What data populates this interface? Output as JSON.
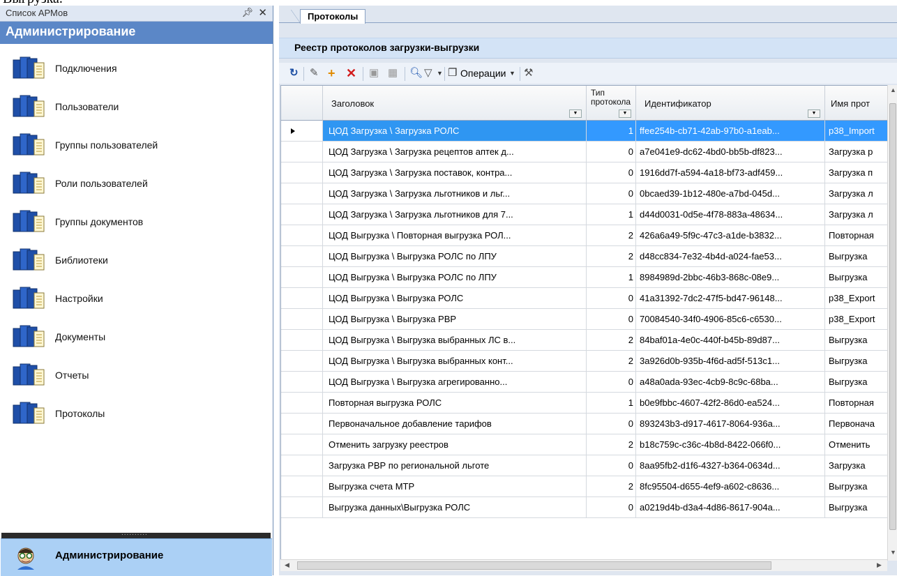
{
  "top_cut_text": "Выгрузка.",
  "left_panel": {
    "caption": "Список АРМов",
    "pin_icon": "pin-icon",
    "close_symbol": "✕",
    "header": "Администрирование",
    "items": [
      {
        "label": "Подключения"
      },
      {
        "label": "Пользователи"
      },
      {
        "label": "Группы пользователей"
      },
      {
        "label": "Роли пользователей"
      },
      {
        "label": "Группы документов"
      },
      {
        "label": "Библиотеки"
      },
      {
        "label": "Настройки"
      },
      {
        "label": "Документы"
      },
      {
        "label": "Отчеты"
      },
      {
        "label": "Протоколы"
      }
    ],
    "splitter_dots": "..........",
    "bottom_label": "Администрирование"
  },
  "tab": {
    "label": "Протоколы"
  },
  "panel_title": "Реестр протоколов загрузки-выгрузки",
  "toolbar": {
    "operations_label": "Операции"
  },
  "grid": {
    "columns": [
      "Заголовок",
      "Тип протокола",
      "Идентификатор",
      "Имя прот"
    ],
    "rows": [
      [
        "ЦОД Загрузка \\ Загрузка РОЛС",
        "1",
        "ffee254b-cb71-42ab-97b0-a1eab...",
        "p38_Import"
      ],
      [
        "ЦОД Загрузка \\ Загрузка рецептов аптек д...",
        "0",
        "a7e041e9-dc62-4bd0-bb5b-df823...",
        "Загрузка р"
      ],
      [
        "ЦОД Загрузка \\ Загрузка поставок, контра...",
        "0",
        "1916dd7f-a594-4a18-bf73-adf459...",
        "Загрузка п"
      ],
      [
        "ЦОД Загрузка \\ Загрузка льготников и льг...",
        "0",
        "0bcaed39-1b12-480e-a7bd-045d...",
        "Загрузка л"
      ],
      [
        "ЦОД Загрузка \\ Загрузка льготников для 7...",
        "1",
        "d44d0031-0d5e-4f78-883a-48634...",
        "Загрузка л"
      ],
      [
        "ЦОД Выгрузка \\ Повторная выгрузка РОЛ...",
        "2",
        "426a6a49-5f9c-47c3-a1de-b3832...",
        "Повторная"
      ],
      [
        "ЦОД Выгрузка \\ Выгрузка РОЛС по ЛПУ",
        "2",
        "d48cc834-7e32-4b4d-a024-fae53...",
        "Выгрузка"
      ],
      [
        "ЦОД Выгрузка \\ Выгрузка РОЛС по ЛПУ",
        "1",
        "8984989d-2bbc-46b3-868c-08e9...",
        "Выгрузка"
      ],
      [
        "ЦОД Выгрузка \\ Выгрузка РОЛС",
        "0",
        "41a31392-7dc2-47f5-bd47-96148...",
        "p38_Export"
      ],
      [
        "ЦОД Выгрузка \\ Выгрузка РВР",
        "0",
        "70084540-34f0-4906-85c6-c6530...",
        "p38_Export"
      ],
      [
        "ЦОД Выгрузка \\ Выгрузка выбранных ЛС в...",
        "2",
        "84baf01a-4e0c-440f-b45b-89d87...",
        "Выгрузка"
      ],
      [
        "ЦОД Выгрузка \\ Выгрузка выбранных конт...",
        "2",
        "3a926d0b-935b-4f6d-ad5f-513c1...",
        "Выгрузка"
      ],
      [
        "ЦОД Выгрузка \\  Выгрузка агрегированно...",
        "0",
        "a48a0ada-93ec-4cb9-8c9c-68ba...",
        "Выгрузка"
      ],
      [
        "Повторная выгрузка РОЛС",
        "1",
        "b0e9fbbc-4607-42f2-86d0-ea524...",
        "Повторная"
      ],
      [
        "Первоначальное добавление тарифов",
        "0",
        "893243b3-d917-4617-8064-936a...",
        "Первонача"
      ],
      [
        "Отменить загрузку реестров",
        "2",
        "b18c759c-c36c-4b8d-8422-066f0...",
        "Отменить"
      ],
      [
        "Загрузка РВР по региональной льготе",
        "0",
        "8aa95fb2-d1f6-4327-b364-0634d...",
        "Загрузка"
      ],
      [
        "Выгрузка счета  МТР",
        "2",
        "8fc95504-d655-4ef9-a602-c8636...",
        "Выгрузка"
      ],
      [
        "Выгрузка данных\\Выгрузка РОЛС",
        "0",
        "a0219d4b-d3a4-4d86-8617-904a...",
        "Выгрузка"
      ]
    ],
    "selected_row": 0
  },
  "colors": {
    "selection": "#3399ff",
    "header_bar": "#5b87c7",
    "bottom_bar": "#abd0f5"
  }
}
